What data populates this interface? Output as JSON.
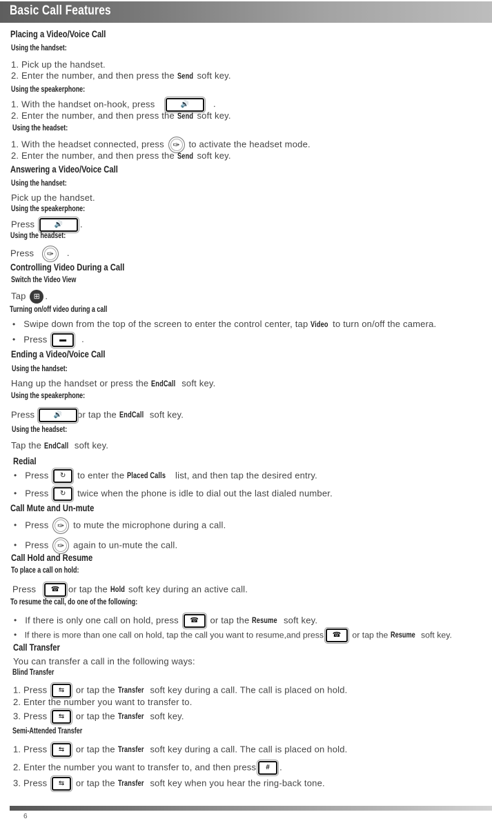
{
  "header": {
    "title": "Basic Call Features"
  },
  "icons": {
    "speaker": "🔊",
    "headset": "✑",
    "layout": "⊞",
    "video_off": "▬",
    "redial": "↻",
    "hold": "☎",
    "transfer": "⇆",
    "pound": "#"
  },
  "placing": {
    "title": "Placing a Video/Voice Call",
    "handset_label": "Using the handset:",
    "handset_step1": "1. Pick up the handset.",
    "handset_step2_pre": "2. Enter the number, and then press the",
    "handset_step2_kw": "Send",
    "handset_step2_post": "soft key.",
    "speaker_label": "Using the speakerphone:",
    "speaker_step1_pre": "1. With the handset on-hook, press",
    "speaker_step1_post": ".",
    "speaker_step2_pre": "2. Enter the number, and then press the",
    "speaker_step2_kw": "Send",
    "speaker_step2_post": "soft key.",
    "headset_label": "Using the headset:",
    "headset_step1_pre": "1. With the headset connected, press",
    "headset_step1_post": "to activate the headset mode.",
    "headset_step2_pre": "2. Enter the number, and then press the",
    "headset_step2_kw": "Send",
    "headset_step2_post": "soft key."
  },
  "answering": {
    "title": "Answering a Video/Voice Call",
    "handset_label": "Using the handset:",
    "handset_text": "Pick up the handset.",
    "speaker_label": "Using the speakerphone:",
    "speaker_pre": "Press",
    "speaker_post": ".",
    "headset_label": "Using the headset:",
    "headset_pre": "Press",
    "headset_post": "."
  },
  "video": {
    "title": "Controlling Video During a Call",
    "switch_label": "Switch the Video View",
    "switch_pre": "Tap",
    "switch_post": ".",
    "toggle_label": "Turning on/off video during a call",
    "toggle_b1_pre": "Swipe down from the top of the screen to enter the control center, tap",
    "toggle_b1_kw": "Video",
    "toggle_b1_post": "to turn on/off the camera.",
    "toggle_b2_pre": "Press",
    "toggle_b2_post": "."
  },
  "ending": {
    "title": "Ending a Video/Voice Call",
    "handset_label": "Using the handset:",
    "handset_pre": "Hang up the handset or press the",
    "handset_kw": "EndCall",
    "handset_post": "soft key.",
    "speaker_label": "Using the speakerphone:",
    "speaker_pre": "Press",
    "speaker_mid": "or tap the",
    "speaker_kw": "EndCall",
    "speaker_post": "soft key.",
    "headset_label": "Using the headset:",
    "headset_pre": "Tap the",
    "headset_kw": "EndCall",
    "headset_post": "soft key."
  },
  "redial": {
    "title": "Redial",
    "b1_pre": "Press",
    "b1_mid": "to enter the",
    "b1_kw": "Placed Calls",
    "b1_post": "list, and then tap the desired entry.",
    "b2_pre": "Press",
    "b2_post": "twice when the phone is idle to dial out the last dialed number."
  },
  "mute": {
    "title": "Call Mute and Un-mute",
    "b1_pre": "Press",
    "b1_post": "to mute the microphone during a call.",
    "b2_pre": "Press",
    "b2_post": "again to un-mute the call."
  },
  "hold": {
    "title": "Call Hold and Resume",
    "place_label": "To place a call on hold:",
    "place_pre": "Press",
    "place_mid": "or tap the",
    "place_kw": "Hold",
    "place_post": "soft key during an active call.",
    "resume_label": "To resume the call, do one of the following:",
    "r1_pre": "If there is only one call on hold, press",
    "r1_mid": "or tap the",
    "r1_kw": "Resume",
    "r1_post": "soft key.",
    "r2_pre": "If there is more than one call on hold, tap the call you want to resume,and press",
    "r2_mid": "or tap the",
    "r2_kw": "Resume",
    "r2_post": "soft key."
  },
  "transfer": {
    "title": "Call Transfer",
    "intro": "You can transfer a call in the following ways:",
    "blind_label": "Blind Transfer",
    "blind_1_pre": "1. Press",
    "blind_1_mid": "or tap the",
    "blind_1_kw": "Transfer",
    "blind_1_post": "soft key during a call. The call is placed on hold.",
    "blind_2": "2. Enter the number you want to transfer to.",
    "blind_3_pre": "3. Press",
    "blind_3_mid": "or tap the",
    "blind_3_kw": "Transfer",
    "blind_3_post": "soft key.",
    "semi_label": "Semi-Attended Transfer",
    "semi_1_pre": "1. Press",
    "semi_1_mid": "or tap the",
    "semi_1_kw": "Transfer",
    "semi_1_post": "soft key during a call. The call is placed on hold.",
    "semi_2_pre": "2. Enter the number you want to transfer to, and then press",
    "semi_2_post": ".",
    "semi_3_pre": "3. Press",
    "semi_3_mid": "or tap the",
    "semi_3_kw": "Transfer",
    "semi_3_post": "soft key when you hear the ring-back tone."
  },
  "footer": {
    "page_number": "6"
  }
}
